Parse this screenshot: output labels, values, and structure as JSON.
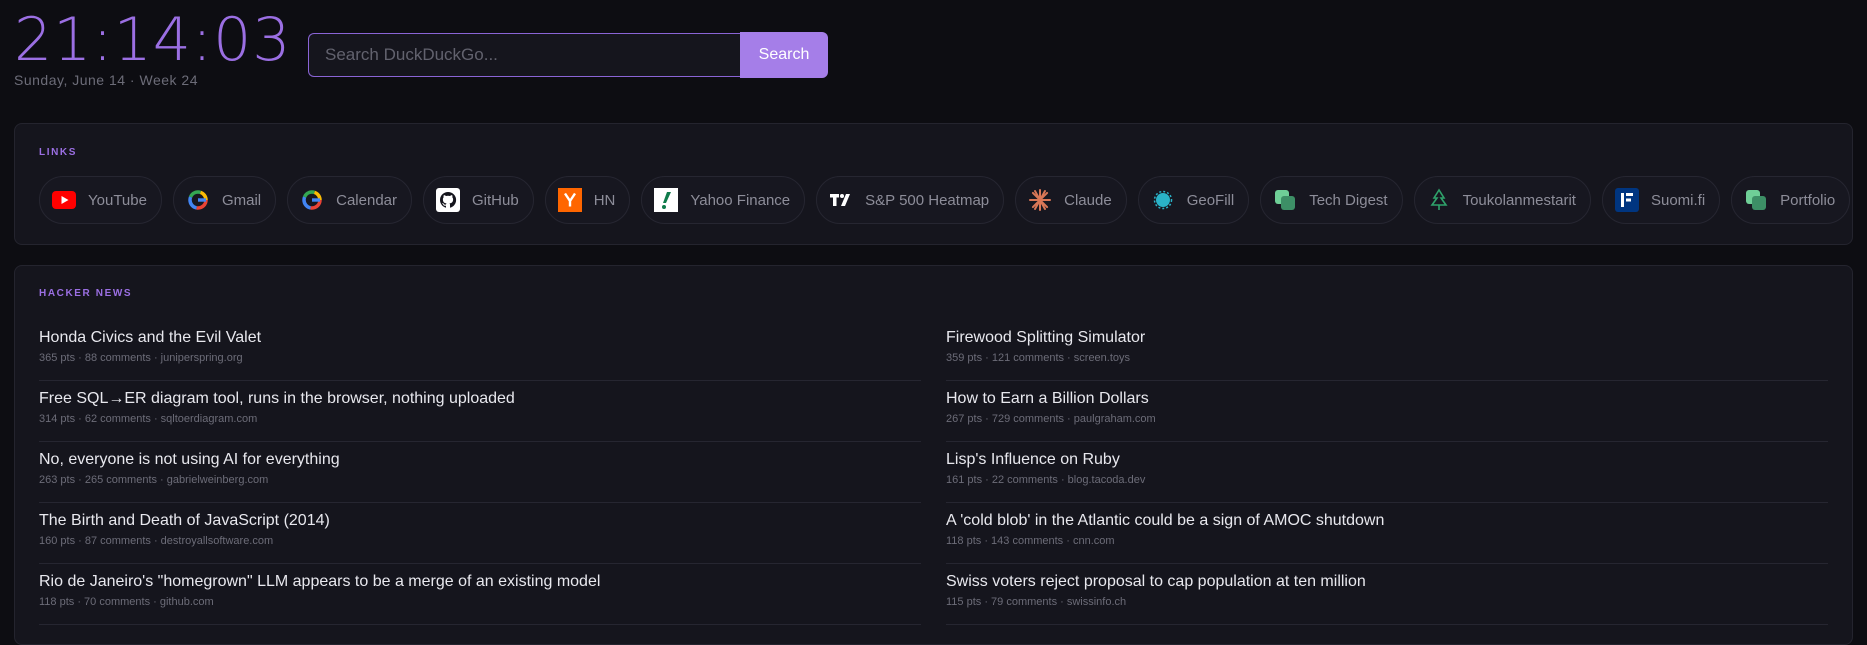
{
  "clock": {
    "time": "21:14:03",
    "date": "Sunday, June 14 · Week 24"
  },
  "search": {
    "placeholder": "Search DuckDuckGo...",
    "button_label": "Search"
  },
  "links": {
    "label": "LINKS",
    "items": [
      {
        "label": "YouTube",
        "icon": "youtube-icon"
      },
      {
        "label": "Gmail",
        "icon": "google-icon"
      },
      {
        "label": "Calendar",
        "icon": "google-icon"
      },
      {
        "label": "GitHub",
        "icon": "github-icon"
      },
      {
        "label": "HN",
        "icon": "hacker-news-icon"
      },
      {
        "label": "Yahoo Finance",
        "icon": "yahoo-finance-icon"
      },
      {
        "label": "S&P 500 Heatmap",
        "icon": "tradingview-icon"
      },
      {
        "label": "Claude",
        "icon": "claude-icon"
      },
      {
        "label": "GeoFill",
        "icon": "geofill-icon"
      },
      {
        "label": "Tech Digest",
        "icon": "tech-digest-icon"
      },
      {
        "label": "Toukolanmestarit",
        "icon": "tree-icon"
      },
      {
        "label": "Suomi.fi",
        "icon": "suomi-icon"
      },
      {
        "label": "Portfolio",
        "icon": "portfolio-icon"
      }
    ]
  },
  "hacker_news": {
    "label": "HACKER NEWS",
    "left": [
      {
        "title": "Honda Civics and the Evil Valet",
        "meta": "365 pts · 88 comments · juniperspring.org"
      },
      {
        "title": "Free SQL→ER diagram tool, runs in the browser, nothing uploaded",
        "meta": "314 pts · 62 comments · sqltoerdiagram.com"
      },
      {
        "title": "No, everyone is not using AI for everything",
        "meta": "263 pts · 265 comments · gabrielweinberg.com"
      },
      {
        "title": "The Birth and Death of JavaScript (2014)",
        "meta": "160 pts · 87 comments · destroyallsoftware.com"
      },
      {
        "title": "Rio de Janeiro's \"homegrown\" LLM appears to be a merge of an existing model",
        "meta": "118 pts · 70 comments · github.com"
      }
    ],
    "right": [
      {
        "title": "Firewood Splitting Simulator",
        "meta": "359 pts · 121 comments · screen.toys"
      },
      {
        "title": "How to Earn a Billion Dollars",
        "meta": "267 pts · 729 comments · paulgraham.com"
      },
      {
        "title": "Lisp's Influence on Ruby",
        "meta": "161 pts · 22 comments · blog.tacoda.dev"
      },
      {
        "title": "A 'cold blob' in the Atlantic could be a sign of AMOC shutdown",
        "meta": "118 pts · 143 comments · cnn.com"
      },
      {
        "title": "Swiss voters reject proposal to cap population at ten million",
        "meta": "115 pts · 79 comments · swissinfo.ch"
      }
    ]
  }
}
